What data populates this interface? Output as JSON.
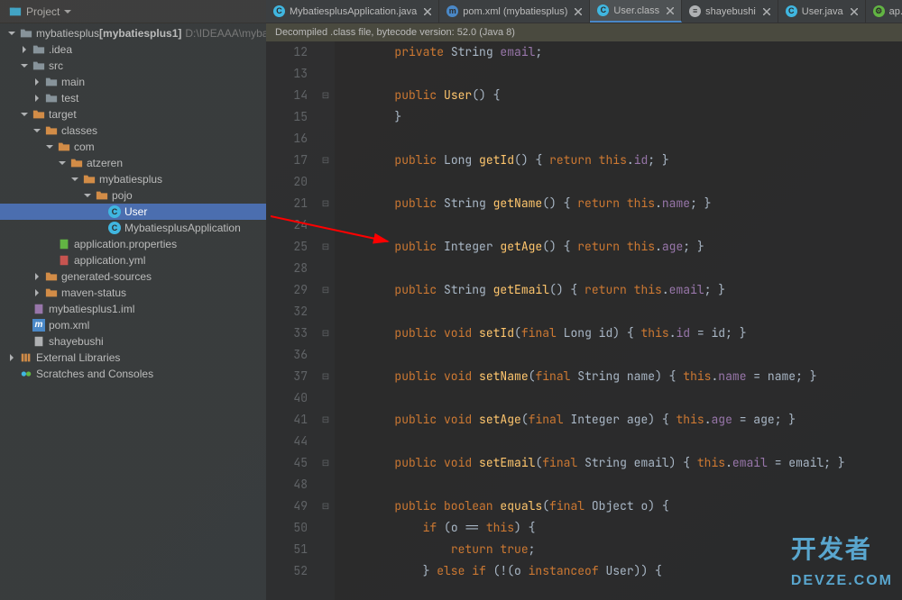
{
  "project_button": "Project",
  "banner": "Decompiled .class file, bytecode version: 52.0 (Java 8)",
  "tabs": [
    {
      "label": "MybatiesplusApplication.java",
      "icon": "class",
      "active": false
    },
    {
      "label": "pom.xml (mybatiesplus)",
      "icon": "maven",
      "active": false
    },
    {
      "label": "User.class",
      "icon": "class",
      "active": true
    },
    {
      "label": "shayebushi",
      "icon": "txt",
      "active": false
    },
    {
      "label": "User.java",
      "icon": "class",
      "active": false
    },
    {
      "label": "ap...",
      "icon": "props",
      "active": false
    }
  ],
  "tree": [
    {
      "indent": 0,
      "arrow": "down",
      "icon": "folder-root",
      "label": "mybatiesplus",
      "extra": "[mybatiesplus1]",
      "dim": "D:\\IDEAAA\\myba"
    },
    {
      "indent": 1,
      "arrow": "right",
      "icon": "folder",
      "label": ".idea"
    },
    {
      "indent": 1,
      "arrow": "down",
      "icon": "folder",
      "label": "src"
    },
    {
      "indent": 2,
      "arrow": "right",
      "icon": "folder",
      "label": "main"
    },
    {
      "indent": 2,
      "arrow": "right",
      "icon": "folder",
      "label": "test"
    },
    {
      "indent": 1,
      "arrow": "down",
      "icon": "folder-orange",
      "label": "target"
    },
    {
      "indent": 2,
      "arrow": "down",
      "icon": "folder-orange",
      "label": "classes"
    },
    {
      "indent": 3,
      "arrow": "down",
      "icon": "folder-orange",
      "label": "com"
    },
    {
      "indent": 4,
      "arrow": "down",
      "icon": "folder-orange",
      "label": "atzeren"
    },
    {
      "indent": 5,
      "arrow": "down",
      "icon": "folder-orange",
      "label": "mybatiesplus"
    },
    {
      "indent": 6,
      "arrow": "down",
      "icon": "folder-orange",
      "label": "pojo"
    },
    {
      "indent": 7,
      "arrow": "none",
      "icon": "class",
      "label": "User",
      "selected": true
    },
    {
      "indent": 7,
      "arrow": "none",
      "icon": "class",
      "label": "MybatiesplusApplication"
    },
    {
      "indent": 3,
      "arrow": "none",
      "icon": "props",
      "label": "application.properties"
    },
    {
      "indent": 3,
      "arrow": "none",
      "icon": "yaml",
      "label": "application.yml"
    },
    {
      "indent": 2,
      "arrow": "right",
      "icon": "folder-orange",
      "label": "generated-sources"
    },
    {
      "indent": 2,
      "arrow": "right",
      "icon": "folder-orange",
      "label": "maven-status"
    },
    {
      "indent": 1,
      "arrow": "none",
      "icon": "iml",
      "label": "mybatiesplus1.iml"
    },
    {
      "indent": 1,
      "arrow": "none",
      "icon": "maven",
      "label": "pom.xml"
    },
    {
      "indent": 1,
      "arrow": "none",
      "icon": "txt",
      "label": "shayebushi"
    },
    {
      "indent": 0,
      "arrow": "right",
      "icon": "lib",
      "label": "External Libraries"
    },
    {
      "indent": 0,
      "arrow": "none",
      "icon": "scratch",
      "label": "Scratches and Consoles"
    }
  ],
  "line_numbers": [
    "12",
    "13",
    "14",
    "15",
    "16",
    "17",
    "20",
    "21",
    "24",
    "25",
    "28",
    "29",
    "32",
    "33",
    "36",
    "37",
    "40",
    "41",
    "44",
    "45",
    "48",
    "49",
    "50",
    "51",
    "52"
  ],
  "code_lines": [
    {
      "html": "        <span class='kw'>private</span> String <span class='fn'>email</span>;"
    },
    {
      "html": ""
    },
    {
      "html": "        <span class='kw'>public</span> <span class='mth'>User</span>() {"
    },
    {
      "html": "        }"
    },
    {
      "html": ""
    },
    {
      "html": "        <span class='kw'>public</span> Long <span class='mth'>getId</span>() { <span class='kw'>return this</span>.<span class='fn'>id</span>; }"
    },
    {
      "html": ""
    },
    {
      "html": "        <span class='kw'>public</span> String <span class='mth'>getName</span>() { <span class='kw'>return this</span>.<span class='fn'>name</span>; }"
    },
    {
      "html": ""
    },
    {
      "html": "        <span class='kw'>public</span> Integer <span class='mth'>getAge</span>() { <span class='kw'>return this</span>.<span class='fn'>age</span>; }"
    },
    {
      "html": ""
    },
    {
      "html": "        <span class='kw'>public</span> String <span class='mth'>getEmail</span>() { <span class='kw'>return this</span>.<span class='fn'>email</span>; }"
    },
    {
      "html": ""
    },
    {
      "html": "        <span class='kw'>public void</span> <span class='mth'>setId</span>(<span class='kw'>final</span> Long id) { <span class='kw'>this</span>.<span class='fn'>id</span> = id; }"
    },
    {
      "html": ""
    },
    {
      "html": "        <span class='kw'>public void</span> <span class='mth'>setName</span>(<span class='kw'>final</span> String name) { <span class='kw'>this</span>.<span class='fn'>name</span> = name; }"
    },
    {
      "html": ""
    },
    {
      "html": "        <span class='kw'>public void</span> <span class='mth'>setAge</span>(<span class='kw'>final</span> Integer age) { <span class='kw'>this</span>.<span class='fn'>age</span> = age; }"
    },
    {
      "html": ""
    },
    {
      "html": "        <span class='kw'>public void</span> <span class='mth'>setEmail</span>(<span class='kw'>final</span> String email) { <span class='kw'>this</span>.<span class='fn'>email</span> = email; }"
    },
    {
      "html": ""
    },
    {
      "html": "        <span class='kw'>public boolean</span> <span class='mth'>equals</span>(<span class='kw'>final</span> Object o) {"
    },
    {
      "html": "            <span class='kw'>if</span> (o == <span class='kw'>this</span>) {"
    },
    {
      "html": "                <span class='kw'>return true</span>;"
    },
    {
      "html": "            } <span class='kw'>else if</span> (!(o <span class='kw'>instanceof</span> User)) {"
    }
  ],
  "watermark": "开发者\nDevZe.coM"
}
